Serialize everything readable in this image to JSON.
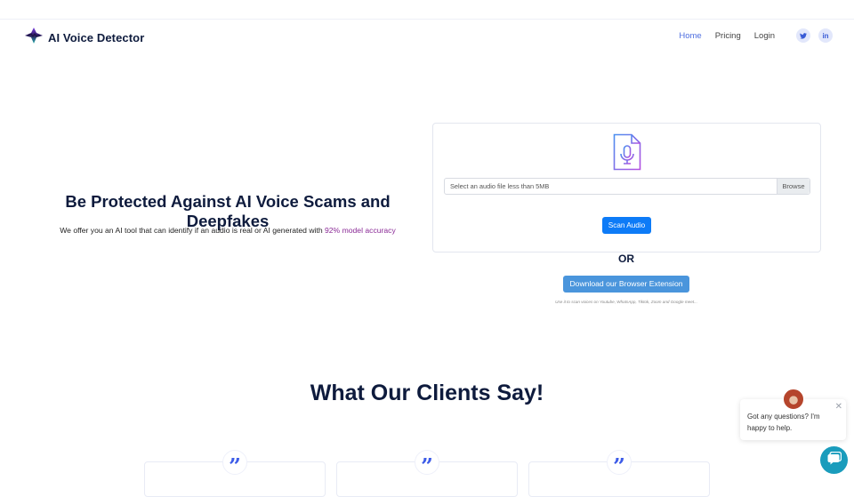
{
  "brand": {
    "name": "AI Voice Detector"
  },
  "nav": {
    "links": [
      {
        "label": "Home",
        "active": true
      },
      {
        "label": "Pricing",
        "active": false
      },
      {
        "label": "Login",
        "active": false
      }
    ],
    "social": [
      {
        "icon": "twitter-icon",
        "glyph": "❦"
      },
      {
        "icon": "linkedin-icon",
        "glyph": "in"
      }
    ]
  },
  "hero": {
    "title": "Be Protected Against AI Voice Scams and Deepfakes",
    "subtitle_prefix": "We offer you an AI tool that can identify if an audio is real or AI generated with ",
    "subtitle_accent": "92% model accuracy"
  },
  "upload": {
    "icon": "audio-file-mic-icon",
    "placeholder": "Select an audio file less than 5MB",
    "browse_label": "Browse",
    "scan_label": "Scan Audio"
  },
  "alt": {
    "or_label": "OR",
    "extension_label": "Download our Browser Extension",
    "extension_note": "Use it to scan voices on Youtube, WhatsApp, Tiktok, Zoom and Google meet..."
  },
  "testimonials": {
    "title": "What Our Clients Say!",
    "quote_glyph": "”",
    "count": 3
  },
  "chat": {
    "message": "Got any questions? I'm happy to help.",
    "close_glyph": "✕"
  },
  "colors": {
    "accent": "#4f6fe0",
    "primary_button": "#0d7bf7",
    "extension_button": "#4a95dc",
    "highlight": "#8a2a96",
    "chat_launcher": "#1a9cbc"
  }
}
